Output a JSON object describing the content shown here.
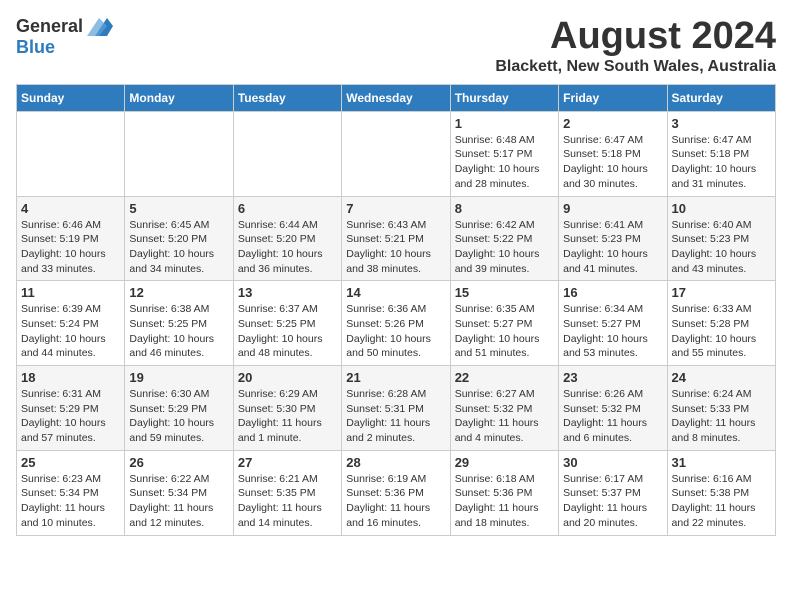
{
  "header": {
    "logo_general": "General",
    "logo_blue": "Blue",
    "month": "August 2024",
    "location": "Blackett, New South Wales, Australia"
  },
  "weekdays": [
    "Sunday",
    "Monday",
    "Tuesday",
    "Wednesday",
    "Thursday",
    "Friday",
    "Saturday"
  ],
  "weeks": [
    [
      {
        "day": "",
        "info": ""
      },
      {
        "day": "",
        "info": ""
      },
      {
        "day": "",
        "info": ""
      },
      {
        "day": "",
        "info": ""
      },
      {
        "day": "1",
        "info": "Sunrise: 6:48 AM\nSunset: 5:17 PM\nDaylight: 10 hours\nand 28 minutes."
      },
      {
        "day": "2",
        "info": "Sunrise: 6:47 AM\nSunset: 5:18 PM\nDaylight: 10 hours\nand 30 minutes."
      },
      {
        "day": "3",
        "info": "Sunrise: 6:47 AM\nSunset: 5:18 PM\nDaylight: 10 hours\nand 31 minutes."
      }
    ],
    [
      {
        "day": "4",
        "info": "Sunrise: 6:46 AM\nSunset: 5:19 PM\nDaylight: 10 hours\nand 33 minutes."
      },
      {
        "day": "5",
        "info": "Sunrise: 6:45 AM\nSunset: 5:20 PM\nDaylight: 10 hours\nand 34 minutes."
      },
      {
        "day": "6",
        "info": "Sunrise: 6:44 AM\nSunset: 5:20 PM\nDaylight: 10 hours\nand 36 minutes."
      },
      {
        "day": "7",
        "info": "Sunrise: 6:43 AM\nSunset: 5:21 PM\nDaylight: 10 hours\nand 38 minutes."
      },
      {
        "day": "8",
        "info": "Sunrise: 6:42 AM\nSunset: 5:22 PM\nDaylight: 10 hours\nand 39 minutes."
      },
      {
        "day": "9",
        "info": "Sunrise: 6:41 AM\nSunset: 5:23 PM\nDaylight: 10 hours\nand 41 minutes."
      },
      {
        "day": "10",
        "info": "Sunrise: 6:40 AM\nSunset: 5:23 PM\nDaylight: 10 hours\nand 43 minutes."
      }
    ],
    [
      {
        "day": "11",
        "info": "Sunrise: 6:39 AM\nSunset: 5:24 PM\nDaylight: 10 hours\nand 44 minutes."
      },
      {
        "day": "12",
        "info": "Sunrise: 6:38 AM\nSunset: 5:25 PM\nDaylight: 10 hours\nand 46 minutes."
      },
      {
        "day": "13",
        "info": "Sunrise: 6:37 AM\nSunset: 5:25 PM\nDaylight: 10 hours\nand 48 minutes."
      },
      {
        "day": "14",
        "info": "Sunrise: 6:36 AM\nSunset: 5:26 PM\nDaylight: 10 hours\nand 50 minutes."
      },
      {
        "day": "15",
        "info": "Sunrise: 6:35 AM\nSunset: 5:27 PM\nDaylight: 10 hours\nand 51 minutes."
      },
      {
        "day": "16",
        "info": "Sunrise: 6:34 AM\nSunset: 5:27 PM\nDaylight: 10 hours\nand 53 minutes."
      },
      {
        "day": "17",
        "info": "Sunrise: 6:33 AM\nSunset: 5:28 PM\nDaylight: 10 hours\nand 55 minutes."
      }
    ],
    [
      {
        "day": "18",
        "info": "Sunrise: 6:31 AM\nSunset: 5:29 PM\nDaylight: 10 hours\nand 57 minutes."
      },
      {
        "day": "19",
        "info": "Sunrise: 6:30 AM\nSunset: 5:29 PM\nDaylight: 10 hours\nand 59 minutes."
      },
      {
        "day": "20",
        "info": "Sunrise: 6:29 AM\nSunset: 5:30 PM\nDaylight: 11 hours\nand 1 minute."
      },
      {
        "day": "21",
        "info": "Sunrise: 6:28 AM\nSunset: 5:31 PM\nDaylight: 11 hours\nand 2 minutes."
      },
      {
        "day": "22",
        "info": "Sunrise: 6:27 AM\nSunset: 5:32 PM\nDaylight: 11 hours\nand 4 minutes."
      },
      {
        "day": "23",
        "info": "Sunrise: 6:26 AM\nSunset: 5:32 PM\nDaylight: 11 hours\nand 6 minutes."
      },
      {
        "day": "24",
        "info": "Sunrise: 6:24 AM\nSunset: 5:33 PM\nDaylight: 11 hours\nand 8 minutes."
      }
    ],
    [
      {
        "day": "25",
        "info": "Sunrise: 6:23 AM\nSunset: 5:34 PM\nDaylight: 11 hours\nand 10 minutes."
      },
      {
        "day": "26",
        "info": "Sunrise: 6:22 AM\nSunset: 5:34 PM\nDaylight: 11 hours\nand 12 minutes."
      },
      {
        "day": "27",
        "info": "Sunrise: 6:21 AM\nSunset: 5:35 PM\nDaylight: 11 hours\nand 14 minutes."
      },
      {
        "day": "28",
        "info": "Sunrise: 6:19 AM\nSunset: 5:36 PM\nDaylight: 11 hours\nand 16 minutes."
      },
      {
        "day": "29",
        "info": "Sunrise: 6:18 AM\nSunset: 5:36 PM\nDaylight: 11 hours\nand 18 minutes."
      },
      {
        "day": "30",
        "info": "Sunrise: 6:17 AM\nSunset: 5:37 PM\nDaylight: 11 hours\nand 20 minutes."
      },
      {
        "day": "31",
        "info": "Sunrise: 6:16 AM\nSunset: 5:38 PM\nDaylight: 11 hours\nand 22 minutes."
      }
    ]
  ]
}
